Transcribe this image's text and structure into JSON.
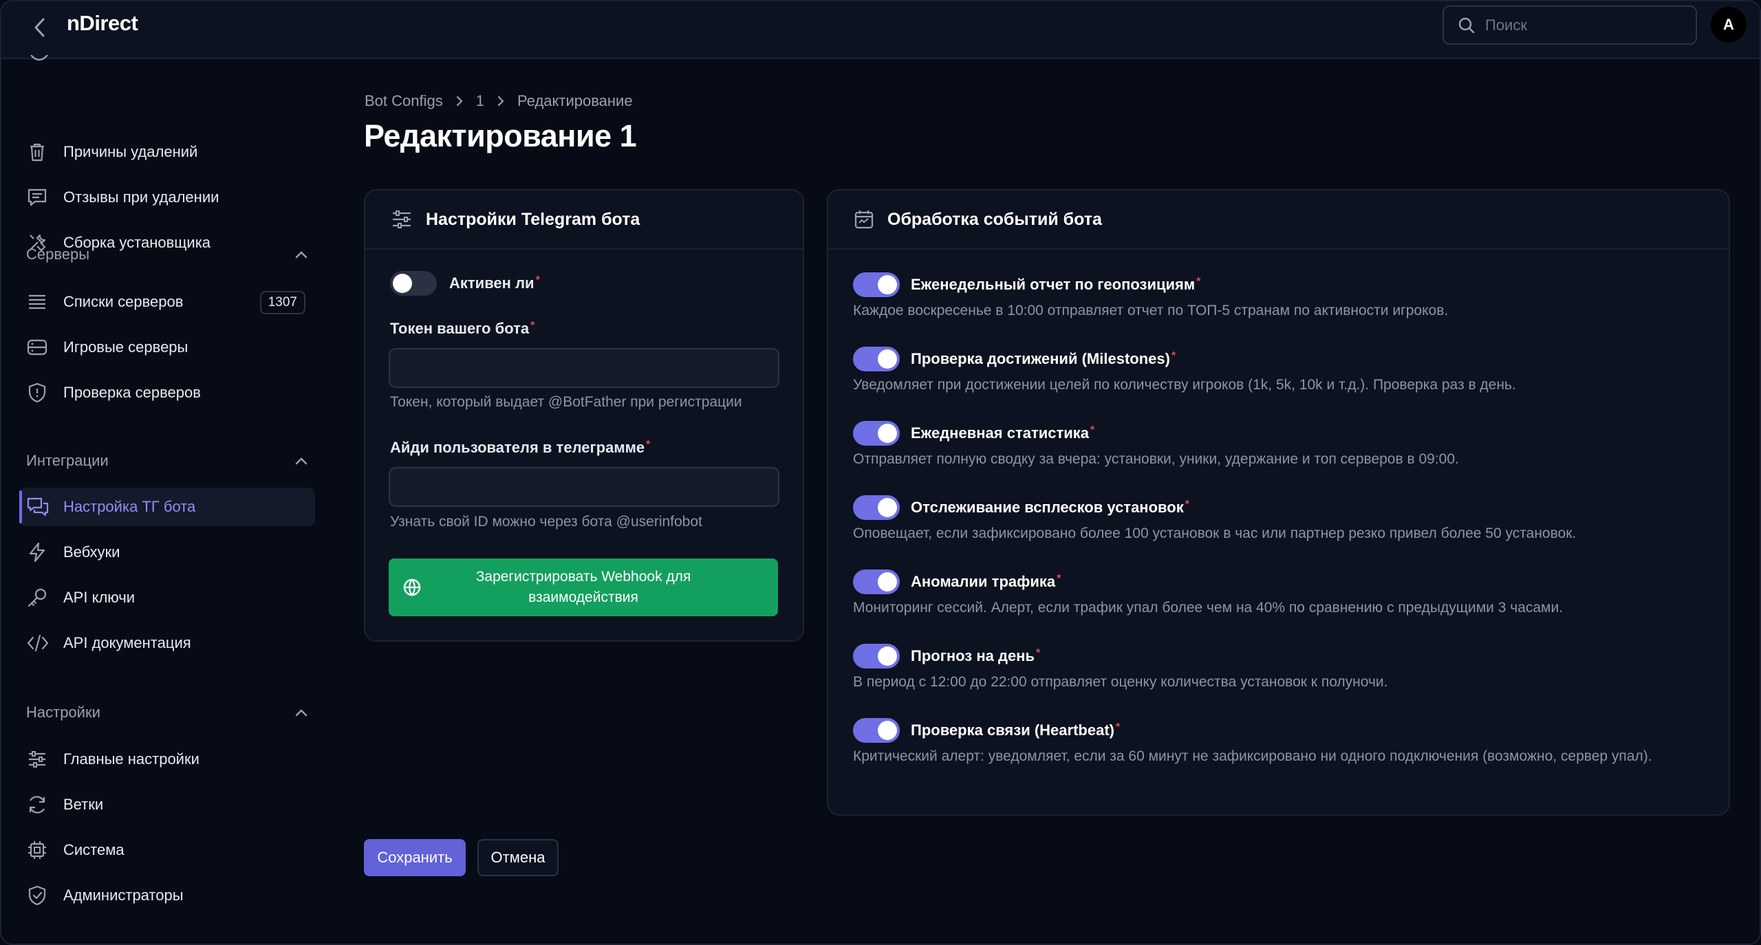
{
  "app": {
    "title": "nDirect"
  },
  "search": {
    "placeholder": "Поиск"
  },
  "user": {
    "avatar_letter": "A"
  },
  "sidebar": {
    "top_items": [
      {
        "label": "Причины удалений",
        "icon": "trash-icon"
      },
      {
        "label": "Отзывы при удалении",
        "icon": "message-icon"
      },
      {
        "label": "Сборка установщика",
        "icon": "tools-icon"
      }
    ],
    "groups": {
      "servers": {
        "label": "Серверы",
        "items": [
          {
            "label": "Списки серверов",
            "icon": "list-icon",
            "badge": "1307"
          },
          {
            "label": "Игровые серверы",
            "icon": "server-icon"
          },
          {
            "label": "Проверка серверов",
            "icon": "shield-icon"
          }
        ]
      },
      "integrations": {
        "label": "Интеграции",
        "items": [
          {
            "label": "Настройка ТГ бота",
            "icon": "chat-icon",
            "active": true
          },
          {
            "label": "Вебхуки",
            "icon": "bolt-icon"
          },
          {
            "label": "API ключи",
            "icon": "key-icon"
          },
          {
            "label": "API документация",
            "icon": "code-icon"
          }
        ]
      },
      "settings": {
        "label": "Настройки",
        "items": [
          {
            "label": "Главные настройки",
            "icon": "sliders-icon"
          },
          {
            "label": "Ветки",
            "icon": "refresh-icon"
          },
          {
            "label": "Система",
            "icon": "cpu-icon"
          },
          {
            "label": "Администраторы",
            "icon": "shield-check-icon"
          }
        ]
      }
    }
  },
  "breadcrumb": [
    "Bot Configs",
    "1",
    "Редактирование"
  ],
  "page": {
    "title": "Редактирование 1"
  },
  "telegram_card": {
    "title": "Настройки Telegram бота",
    "active_label": "Активен ли",
    "active_value": false,
    "token_label": "Токен вашего бота",
    "token_value": "",
    "token_hint": "Токен, который выдает @BotFather при регистрации",
    "user_id_label": "Айди пользователя в телеграмме",
    "user_id_value": "",
    "user_id_hint": "Узнать свой ID можно через бота @userinfobot",
    "webhook_button": "Зарегистрировать Webhook для взаимодействия"
  },
  "events_card": {
    "title": "Обработка событий бота",
    "events": [
      {
        "title": "Еженедельный отчет по геопозициям",
        "enabled": true,
        "description": "Каждое воскресенье в 10:00 отправляет отчет по ТОП-5 странам по активности игроков."
      },
      {
        "title": "Проверка достижений (Milestones)",
        "enabled": true,
        "description": "Уведомляет при достижении целей по количеству игроков (1k, 5k, 10k и т.д.). Проверка раз в день."
      },
      {
        "title": "Ежедневная статистика",
        "enabled": true,
        "description": "Отправляет полную сводку за вчера: установки, уники, удержание и топ серверов в 09:00."
      },
      {
        "title": "Отслеживание всплесков установок",
        "enabled": true,
        "description": "Оповещает, если зафиксировано более 100 установок в час или партнер резко привел более 50 установок."
      },
      {
        "title": "Аномалии трафика",
        "enabled": true,
        "description": "Мониторинг сессий. Алерт, если трафик упал более чем на 40% по сравнению с предыдущими 3 часами."
      },
      {
        "title": "Прогноз на день",
        "enabled": true,
        "description": "В период с 12:00 до 22:00 отправляет оценку количества установок к полуночи."
      },
      {
        "title": "Проверка связи (Heartbeat)",
        "enabled": true,
        "description": "Критический алерт: уведомляет, если за 60 минут не зафиксировано ни одного подключения (возможно, сервер упал)."
      }
    ]
  },
  "actions": {
    "save": "Сохранить",
    "cancel": "Отмена"
  },
  "colors": {
    "accent": "#6f6fe6",
    "success": "#13a05f",
    "required": "#e5484d",
    "background": "#070b16",
    "surface": "#0d1220"
  }
}
